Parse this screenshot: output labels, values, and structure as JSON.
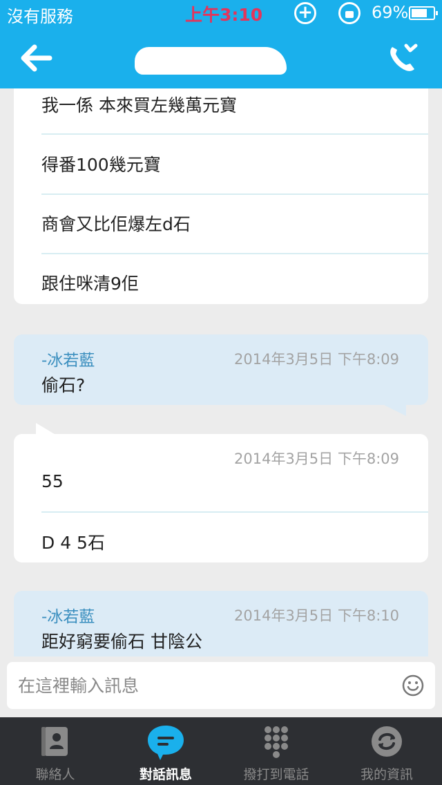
{
  "status": {
    "carrier": "沒有服務",
    "time": "上午3:10",
    "battery": "69%"
  },
  "colors": {
    "brand": "#1ab0ec",
    "bubble_blue": "#dcebf6",
    "tabbar": "#2d2f33",
    "time_red": "#e3355b"
  },
  "header": {
    "back_icon": "arrow-left-icon",
    "call_icon": "phone-icon"
  },
  "messages": {
    "m1": {
      "lines": [
        "我一係 本來買左幾萬元寶",
        "得番100幾元寶",
        "商會又比佢爆左d石",
        "跟住咪清9佢"
      ]
    },
    "m2": {
      "sender": "-冰若藍",
      "time": "2014年3月5日  下午8:09",
      "text": "偷石?"
    },
    "m3": {
      "time": "2014年3月5日  下午8:09",
      "lines": [
        "55",
        "D  4  5石"
      ]
    },
    "m4": {
      "sender": "-冰若藍",
      "time": "2014年3月5日  下午8:10",
      "text": "距好窮要偷石  甘陰公"
    }
  },
  "composer": {
    "placeholder": "在這裡輸入訊息",
    "emoji_icon": "smiley-icon"
  },
  "tabs": [
    {
      "label": "聯絡人",
      "icon": "contacts-icon"
    },
    {
      "label": "對話訊息",
      "icon": "chat-bubble-icon"
    },
    {
      "label": "撥打到電話",
      "icon": "dialpad-icon"
    },
    {
      "label": "我的資訊",
      "icon": "profile-icon"
    }
  ]
}
